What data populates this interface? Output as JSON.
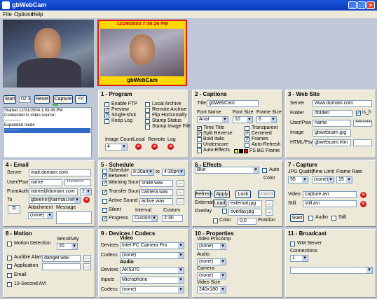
{
  "window": {
    "title": "gbWebCam",
    "min": "_",
    "max": "□",
    "close": "×"
  },
  "menu": {
    "file": "File",
    "options": "Options",
    "help": "Help"
  },
  "preview": {
    "stamp_time": "12/29/2004 7:38:26 PM",
    "stamp_title": "gbWebCam"
  },
  "controls": {
    "start": "Start",
    "time": "02:30",
    "reset": "Reset",
    "capture": "Capture",
    "collapse": "<<"
  },
  "log": [
    "Started 12/31/2004 1:03:49 PM",
    "Connected to video source!",
    "------------",
    "Expanded mode",
    "-----------"
  ],
  "program": {
    "title": "1 - Program",
    "enable_ftp": "Enable FTP",
    "preview": "Preview",
    "single_shot": "Single-shot",
    "keep_log": "Keep Log",
    "local_archive": "Local Archive",
    "remote_archive": "Remote Archive",
    "flip_horiz": "Flip Horizontally",
    "stamp_status": "Stamp Status",
    "stamp_image_file": "Stamp Image File",
    "image_count_label": "Image Count",
    "image_count": "4",
    "local": "Local",
    "remote": "Remote",
    "log": "Log"
  },
  "captions": {
    "title": "2 - Captions",
    "title_label": "Title:",
    "title_value": "gbWebCam",
    "font_name_label": "Font Name",
    "font_name": "Arial",
    "font_size_label": "Font Size",
    "font_size": "10",
    "frame_size_label": "Frame Size",
    "frame_size": "6",
    "time_title": "Time Title",
    "split_reverse": "Split Reverse",
    "bold_italic": "Bold Italic",
    "underscore": "Underscore",
    "auto_effects": "Auto-Effects",
    "transparent": "Transparent",
    "centered": "Centered",
    "frames": "Frames",
    "auto_refresh": "Auto-Refresh",
    "fs_bg_frame": "FS BG Frame",
    "swatches": [
      "#ffff00",
      "#000000",
      "#ff0000"
    ]
  },
  "website": {
    "title": "3 - Web Site",
    "server_label": "Server",
    "server": "www.domain.com",
    "folder_label": "Folder",
    "folder": "/folder/",
    "is_h": "is_h",
    "userpsw_label": "User/Psw",
    "user": "name",
    "psw": "**********",
    "image_label": "Image",
    "image": "gbwebcam.jpg",
    "html_label": "HTML/Psw",
    "html": "gbwebcam.htm"
  },
  "email": {
    "title": "4 - Email",
    "server_label": "Server",
    "server": "mail.domain.com",
    "userpsw_label": "User/Psw",
    "user": "name",
    "psw": "*********",
    "fromauth_label": "FromAuth",
    "from": "name@domain.com",
    "auth": "2",
    "to_label": "To",
    "to": "gbeene@airmail.net",
    "attachment_label": "Attachment",
    "attachment": "(none)",
    "message_label": "Message"
  },
  "schedule": {
    "title": "5 - Schedule",
    "schedule_label": "Schedule",
    "between": "Between",
    "start_time": "8:30am",
    "to": "to",
    "end_time": "4:30pm",
    "warning_sound": "Warning Sound",
    "warning_file": "smile.wav",
    "transfer_sound": "Transfer Sound",
    "transfer_file": "camera.wav",
    "active_sound": "Active Sound",
    "active_file": "active.wav",
    "silent": "Silent",
    "progress": "Progress",
    "interval_label": "Interval",
    "interval": "Custom",
    "custom_label": "Custom",
    "custom": "2:30"
  },
  "effects": {
    "title": "6 - Effects",
    "effect": "Blur",
    "auto": "Auto",
    "color": "Color",
    "refresh": "Refresh",
    "apply": "Apply",
    "lock": "Lock",
    "unlock": "Unlock",
    "external_label": "External",
    "load": "Load",
    "external_file": "external.jpg",
    "overlay_label": "Overlay",
    "overlay_file": "overlay.jpg",
    "color_label": "Color",
    "color_value": "0,0",
    "position_label": "Position"
  },
  "capture": {
    "title": "7 - Capture",
    "jpg_quality_label": "JPG Quality",
    "jpg_quality": "95",
    "time_limit_label": "Time Limit",
    "time_limit": "(none)",
    "frame_rate_label": "Frame Rate",
    "frame_rate": "15",
    "video_label": "Video",
    "video_file": "capture.avi",
    "still_label": "Still",
    "still_file": "still.avi",
    "start": "Start",
    "audio": "Audio",
    "still": "Still"
  },
  "motion": {
    "title": "8 - Motion",
    "motion_detection": "Motion Detection",
    "sensitivity_label": "Sensitivity",
    "sensitivity": "20",
    "audible_alarm": "Audible Alarm",
    "alarm_file": "danger.wav",
    "application": "Application",
    "email": "Email",
    "ten_second_avi": "10-Second AVI"
  },
  "devices": {
    "title": "9 - Devices / Codecs",
    "video_heading": "Video",
    "devices_label": "Devices",
    "video_device": "Intel PC Camera Pro",
    "codecs_label": "Codecs",
    "video_codec": "(none)",
    "audio_heading": "Audio",
    "audio_device": "AK5370",
    "inputs_label": "Inputs",
    "audio_input": "Microphone",
    "audio_codec": "(none)"
  },
  "properties": {
    "title": "10 - Properties",
    "video_procamp_label": "Video ProcAmp",
    "video_procamp": "(none)",
    "audio_label": "Audio",
    "audio": "(none)",
    "camera_label": "Camera",
    "camera": "(none)",
    "video_size_label": "Video Size",
    "video_size": "240x180"
  },
  "broadcast": {
    "title": "11 - Broadcast",
    "wm_server": "WM Server",
    "connections_label": "Connections",
    "connections": "1"
  }
}
